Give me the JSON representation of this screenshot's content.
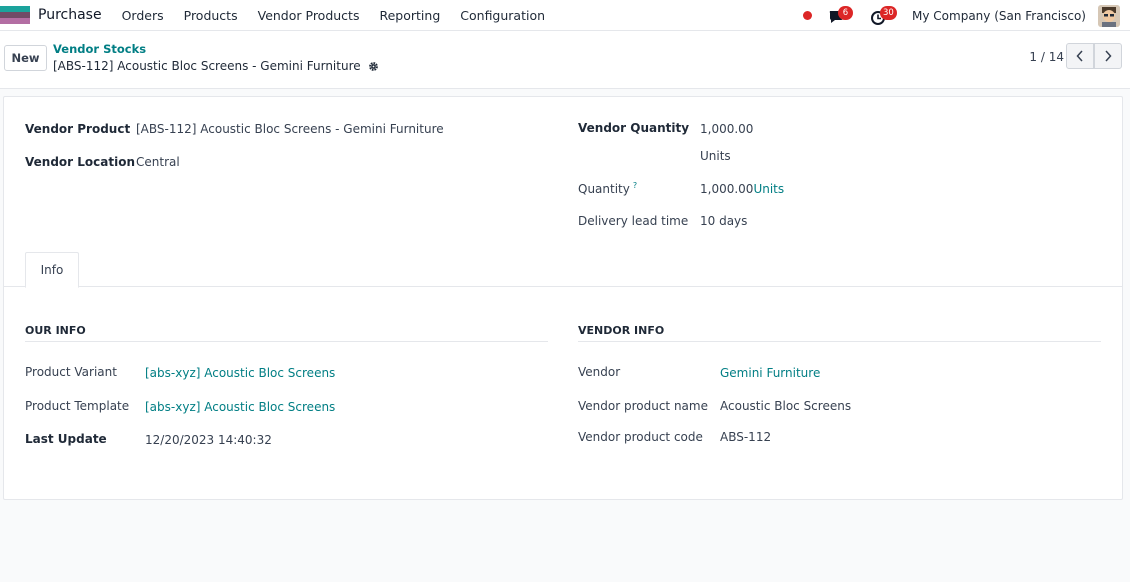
{
  "navbar": {
    "app_name": "Purchase",
    "menu": [
      "Orders",
      "Products",
      "Vendor Products",
      "Reporting",
      "Configuration"
    ],
    "messages_badge": "6",
    "activities_badge": "30",
    "company": "My Company (San Francisco)"
  },
  "control": {
    "new_label": "New",
    "breadcrumb_parent": "Vendor Stocks",
    "record_title": "[ABS-112] Acoustic Bloc Screens - Gemini Furniture",
    "pager": "1 / 14"
  },
  "form": {
    "vendor_product_label": "Vendor Product",
    "vendor_product_value": "[ABS-112] Acoustic Bloc Screens - Gemini Furniture",
    "vendor_location_label": "Vendor Location",
    "vendor_location_value": "Central",
    "vendor_quantity_label": "Vendor Quantity",
    "vendor_quantity_value": "1,000.00",
    "vendor_quantity_uom": "Units",
    "quantity_label": "Quantity",
    "quantity_help": "?",
    "quantity_value": "1,000.00",
    "quantity_uom": "Units",
    "lead_time_label": "Delivery lead time",
    "lead_time_value": "10 days"
  },
  "tabs": {
    "info": "Info"
  },
  "our_info": {
    "title": "OUR INFO",
    "product_variant_label": "Product Variant",
    "product_variant_value": "[abs-xyz] Acoustic Bloc Screens",
    "product_template_label": "Product Template",
    "product_template_value": "[abs-xyz] Acoustic Bloc Screens",
    "last_update_label": "Last Update",
    "last_update_value": "12/20/2023 14:40:32"
  },
  "vendor_info": {
    "title": "VENDOR INFO",
    "vendor_label": "Vendor",
    "vendor_value": "Gemini Furniture",
    "vendor_product_name_label": "Vendor product name",
    "vendor_product_name_value": "Acoustic Bloc Screens",
    "vendor_product_code_label": "Vendor product code",
    "vendor_product_code_value": "ABS-112"
  },
  "colors": {
    "link": "#017e84",
    "badge": "#dc2626",
    "app_brand": "#714b67"
  },
  "icons": [
    "app-icon",
    "record-dot-icon",
    "chat-icon",
    "clock-icon",
    "avatar",
    "gear-icon",
    "chevron-left-icon",
    "chevron-right-icon"
  ]
}
